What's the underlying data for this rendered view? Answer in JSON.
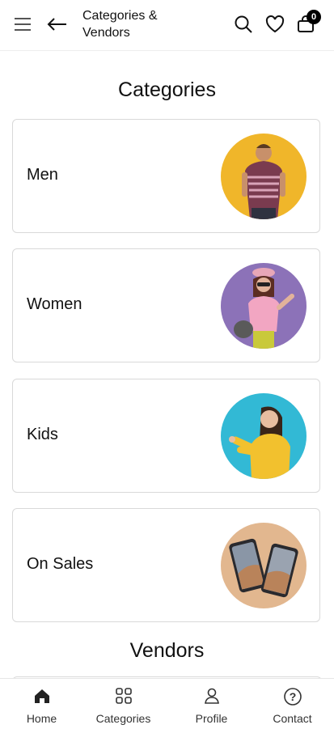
{
  "header": {
    "title": "Categories & Vendors",
    "cart_count": "0",
    "icons": [
      "menu-icon",
      "back-arrow-icon",
      "search-icon",
      "heart-icon",
      "bag-icon"
    ]
  },
  "categories": {
    "title": "Categories",
    "items": [
      {
        "label": "Men",
        "bg": "#f0b62a"
      },
      {
        "label": "Women",
        "bg": "#8c72b8"
      },
      {
        "label": "Kids",
        "bg": "#32b9d5"
      },
      {
        "label": "On Sales",
        "bg": "#e2b78f"
      }
    ]
  },
  "vendors": {
    "title": "Vendors"
  },
  "bottom_nav": {
    "items": [
      {
        "label": "Home",
        "icon": "home-icon"
      },
      {
        "label": "Categories",
        "icon": "grid-icon"
      },
      {
        "label": "Profile",
        "icon": "user-icon"
      },
      {
        "label": "Contact",
        "icon": "help-icon"
      }
    ]
  }
}
